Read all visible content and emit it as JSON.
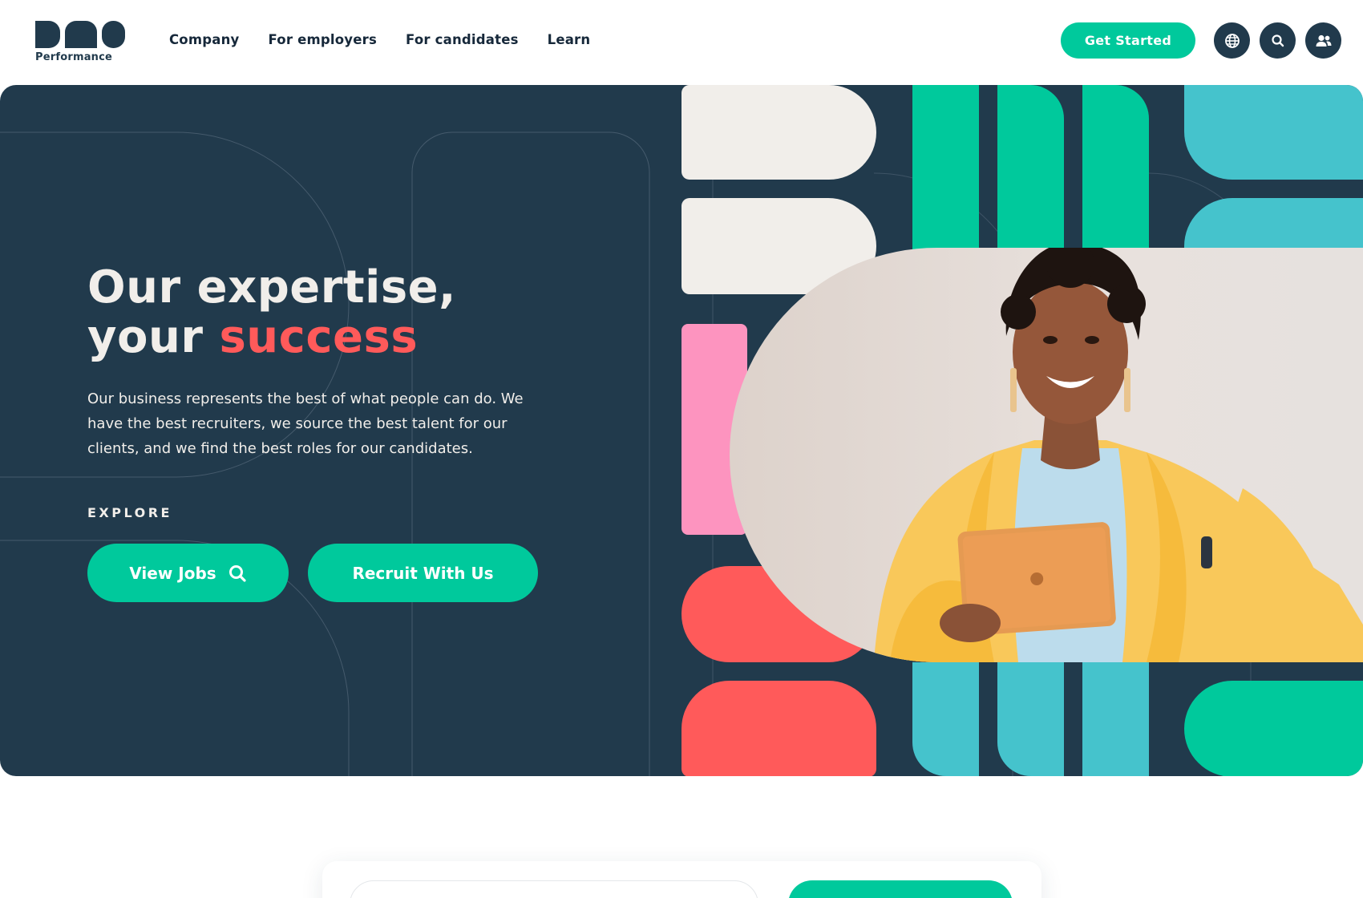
{
  "brand": {
    "logo_text": "BMS",
    "tagline": "Performance"
  },
  "nav": {
    "items": [
      {
        "label": "Company"
      },
      {
        "label": "For employers"
      },
      {
        "label": "For candidates"
      },
      {
        "label": "Learn"
      }
    ]
  },
  "header": {
    "get_started_label": "Get Started",
    "icons": [
      "globe-icon",
      "search-icon",
      "user-group-icon"
    ]
  },
  "hero": {
    "headline_line1": "Our expertise,",
    "headline_line2_prefix": "your ",
    "headline_accent": "success",
    "intro": "Our business represents the best of what people can do. We have the best recruiters, we source the best talent for our clients, and we find the best roles for our candidates.",
    "explore_label": "EXPLORE",
    "view_jobs_label": "View Jobs",
    "recruit_label": "Recruit With Us",
    "photo_alt": "Smiling woman in a yellow blazer holding a tablet"
  },
  "colors": {
    "navy": "#213a4c",
    "green": "#00c99c",
    "coral": "#ff5a5a",
    "teal": "#45c3cc",
    "pink": "#fd94bf",
    "cream": "#f1eeea"
  }
}
